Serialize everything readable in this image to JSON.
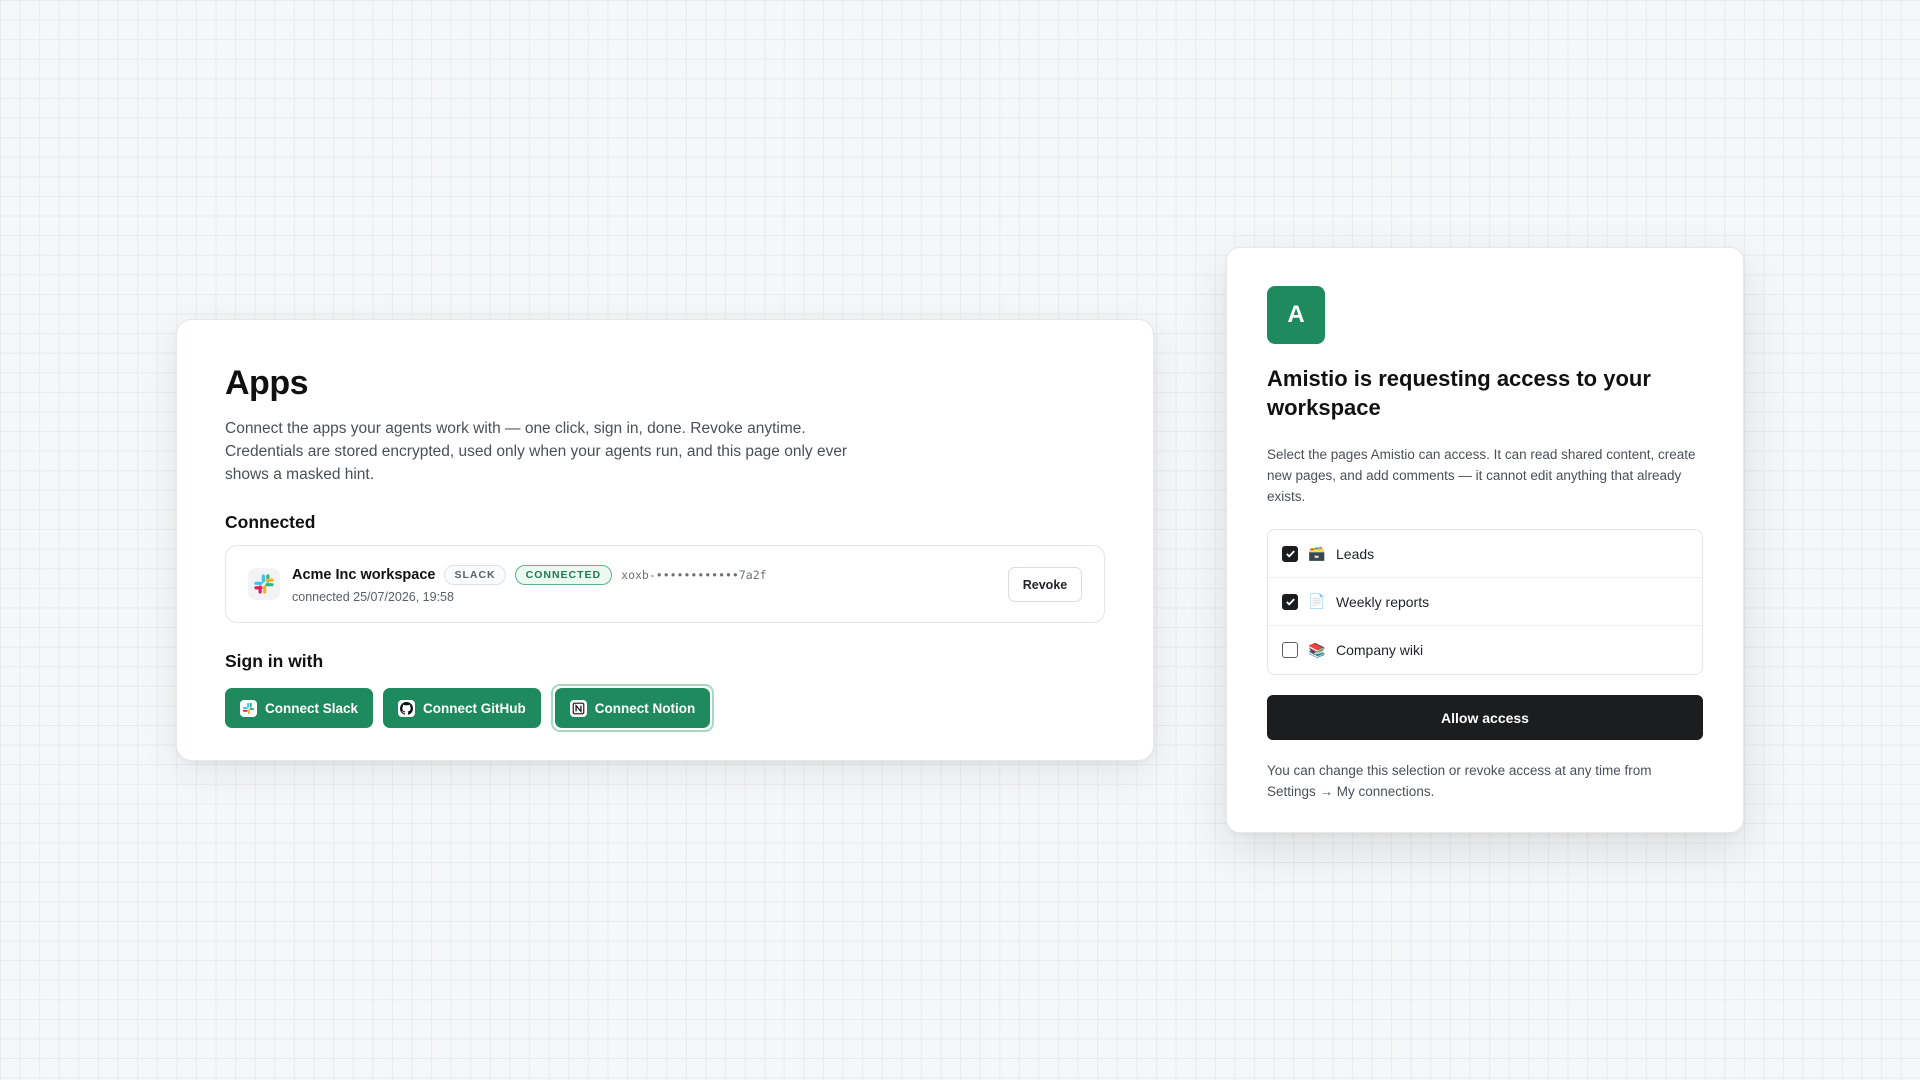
{
  "apps": {
    "title": "Apps",
    "description_lines": [
      "Connect the apps your agents work with — one click, sign in, done. Revoke anytime.",
      "Credentials are stored encrypted, used only when your agents run, and this page only ever",
      "shows a masked hint."
    ],
    "connected_heading": "Connected",
    "connection": {
      "name": "Acme Inc workspace",
      "provider_tag": "SLACK",
      "status": "CONNECTED",
      "token_hint": "xoxb-••••••••••••7a2f",
      "connected_at": "connected 25/07/2026, 19:58",
      "revoke_label": "Revoke"
    },
    "signin_heading": "Sign in with",
    "buttons": {
      "slack": "Connect Slack",
      "github": "Connect GitHub",
      "notion": "Connect Notion"
    }
  },
  "consent": {
    "avatar_letter": "A",
    "title": "Amistio is requesting access to your workspace",
    "description": "Select the pages Amistio can access. It can read shared content, create new pages, and add comments — it cannot edit anything that already exists.",
    "pages": [
      {
        "label": "Leads",
        "emoji": "🗃️",
        "checked": true
      },
      {
        "label": "Weekly reports",
        "emoji": "📄",
        "checked": true
      },
      {
        "label": "Company wiki",
        "emoji": "📚",
        "checked": false
      }
    ],
    "allow_label": "Allow access",
    "footer": "You can change this selection or revoke access at any time from Settings → My connections."
  },
  "colors": {
    "brand_green": "#1f8a5e",
    "dark_button": "#1c1d1f"
  }
}
